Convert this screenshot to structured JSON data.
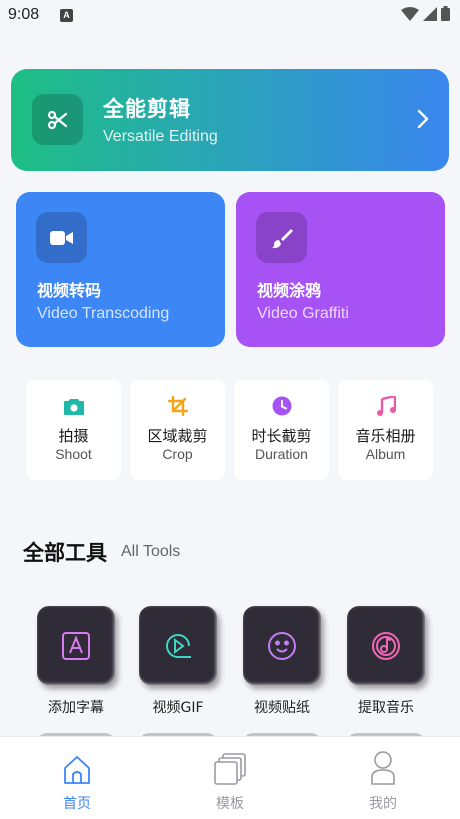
{
  "status_bar": {
    "time": "9:08",
    "notification_badge": "A"
  },
  "hero": {
    "title": "全能剪辑",
    "subtitle": "Versatile Editing",
    "icon": "scissors-icon"
  },
  "cards": [
    {
      "title": "视频转码",
      "subtitle": "Video Transcoding",
      "icon": "video-camera-icon",
      "color": "#3d86f6"
    },
    {
      "title": "视频涂鸦",
      "subtitle": "Video Graffiti",
      "icon": "brush-icon",
      "color": "#a652f4"
    }
  ],
  "quick_tools": [
    {
      "title": "拍摄",
      "subtitle": "Shoot",
      "icon": "camera-icon",
      "color": "#1fb7a8"
    },
    {
      "title": "区域裁剪",
      "subtitle": "Crop",
      "icon": "crop-icon",
      "color": "#f2a51a"
    },
    {
      "title": "时长截剪",
      "subtitle": "Duration",
      "icon": "clock-icon",
      "color": "#a652f4"
    },
    {
      "title": "音乐相册",
      "subtitle": "Album",
      "icon": "music-note-icon",
      "color": "#e85aa6"
    }
  ],
  "all_tools": {
    "title": "全部工具",
    "subtitle": "All Tools",
    "items": [
      {
        "label": "添加字幕",
        "icon": "text-frame-icon"
      },
      {
        "label": "视频GIF",
        "icon": "play-circle-icon"
      },
      {
        "label": "视频贴纸",
        "icon": "smiley-icon"
      },
      {
        "label": "提取音乐",
        "icon": "music-disc-icon"
      }
    ]
  },
  "tabbar": {
    "tabs": [
      {
        "label": "首页",
        "icon": "home-icon",
        "active": true
      },
      {
        "label": "模板",
        "icon": "template-icon",
        "active": false
      },
      {
        "label": "我的",
        "icon": "user-icon",
        "active": false
      }
    ],
    "active_color": "#3d86f6"
  }
}
